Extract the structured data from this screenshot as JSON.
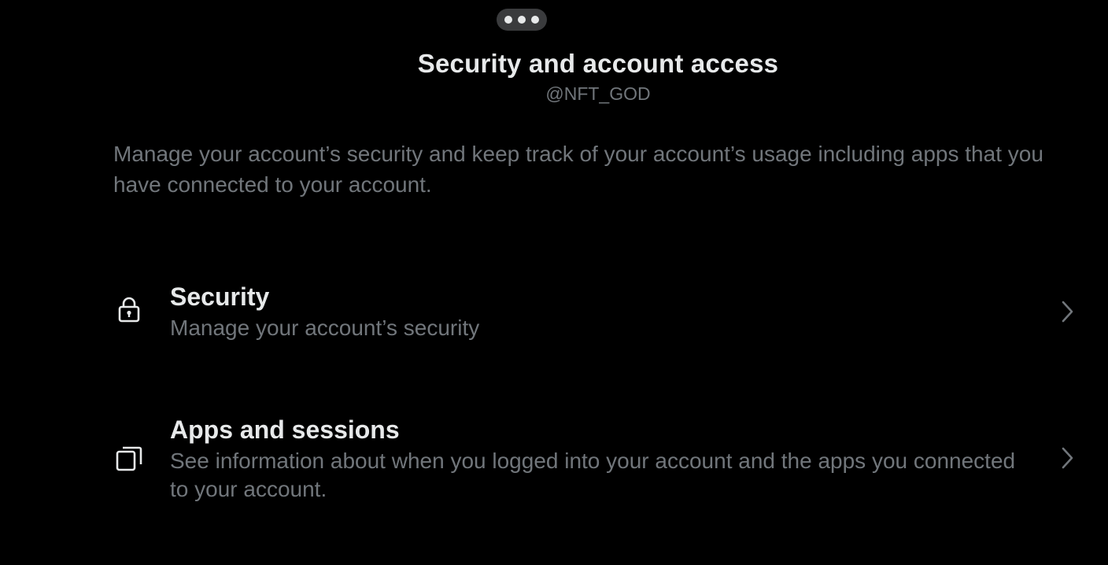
{
  "header": {
    "title": "Security and account access",
    "handle": "@NFT_GOD",
    "more_icon": "more-horizontal-icon"
  },
  "description": "Manage your account’s security and keep track of your account’s usage including apps that you have connected to your account.",
  "items": [
    {
      "icon": "lock-icon",
      "title": "Security",
      "subtitle": "Manage your account’s security"
    },
    {
      "icon": "apps-icon",
      "title": "Apps and sessions",
      "subtitle": "See information about when you logged into your account and the apps you connected to your account."
    }
  ],
  "colors": {
    "background": "#000000",
    "primary_text": "#e7e9ea",
    "secondary_text": "#71767b",
    "pill": "#3a3b3d"
  }
}
